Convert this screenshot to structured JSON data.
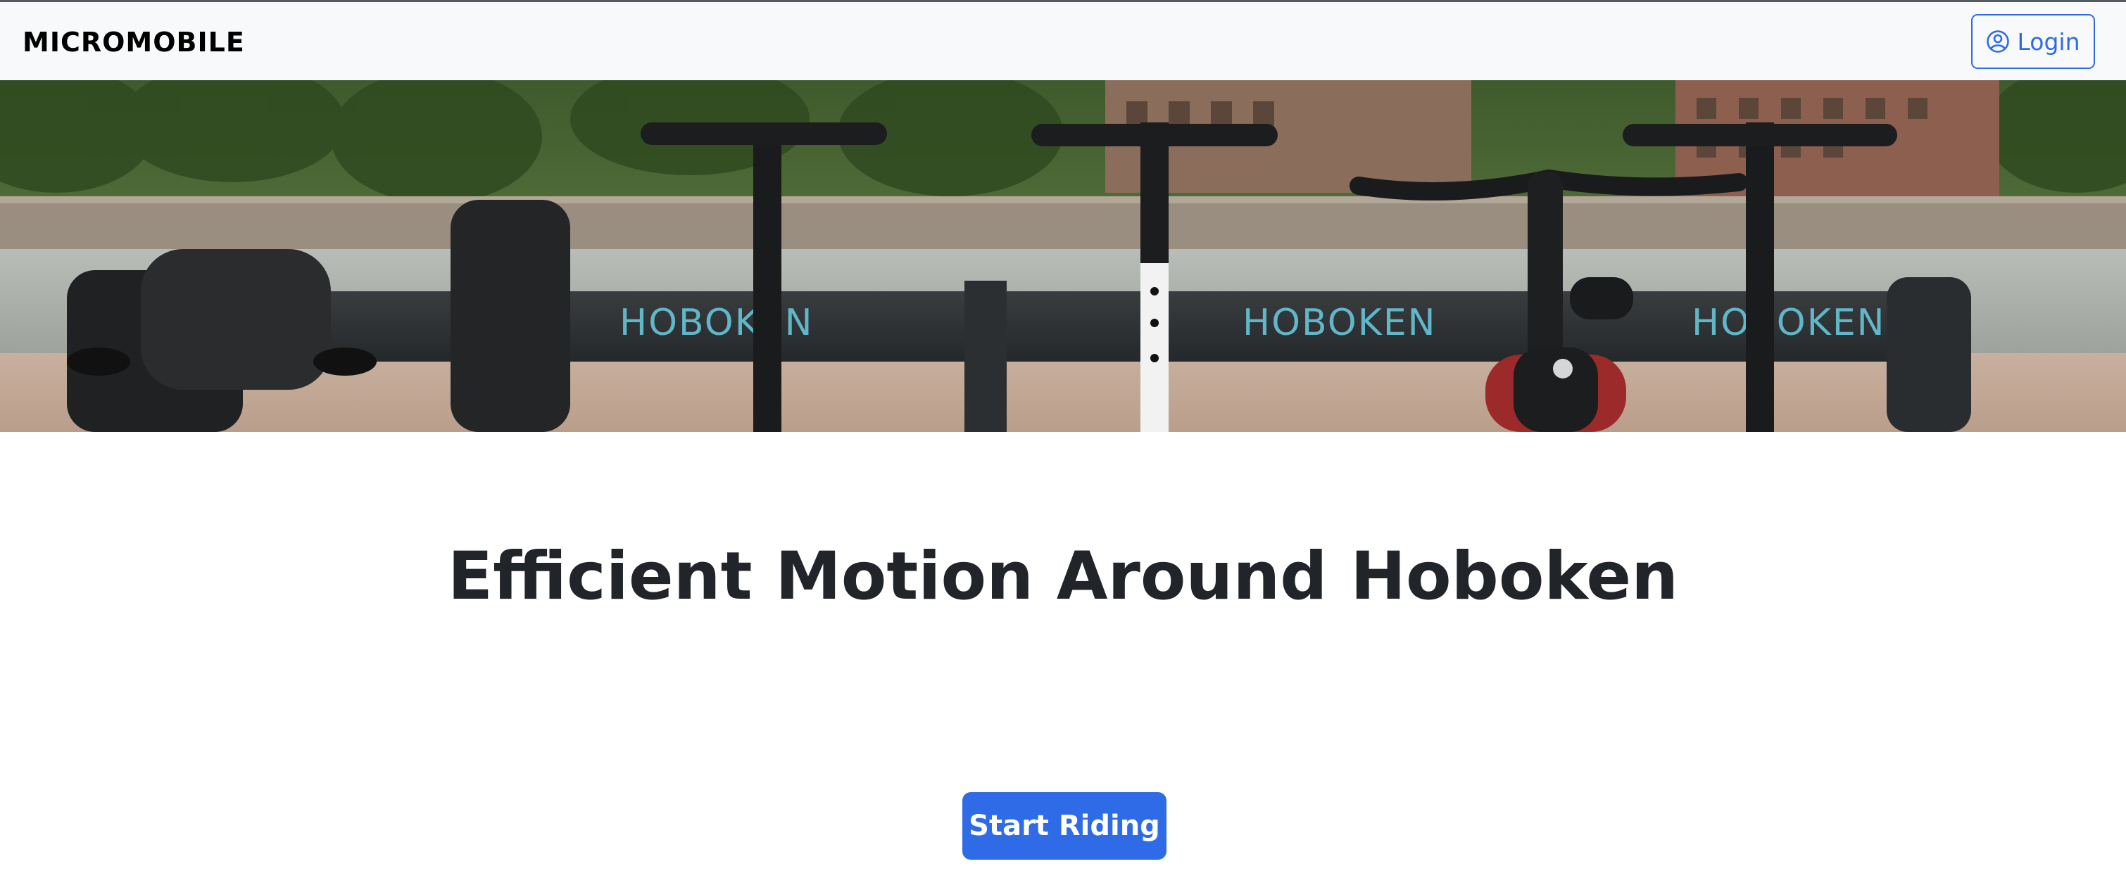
{
  "navbar": {
    "brand": "MICROMOBILE",
    "login_label": "Login",
    "login_icon": "user-circle-icon"
  },
  "hero": {
    "sign_text": "HOBOKEN",
    "vehicles": [
      "mobility-scooter",
      "kick-scooter",
      "kick-scooter",
      "e-bike",
      "kick-scooter"
    ]
  },
  "main": {
    "headline": "Efficient Motion Around Hoboken",
    "cta_label": "Start Riding"
  },
  "colors": {
    "primary": "#2f6be6",
    "navbar_bg": "#f8f9fa",
    "heading": "#212529",
    "sign_text": "#5fb7c7"
  }
}
